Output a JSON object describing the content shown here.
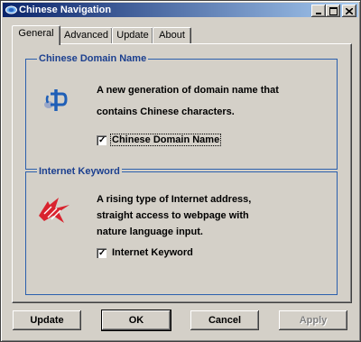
{
  "window": {
    "title": "Chinese Navigation"
  },
  "tabs": [
    {
      "label": "General",
      "active": true
    },
    {
      "label": "Advanced",
      "active": false
    },
    {
      "label": "Update",
      "active": false
    },
    {
      "label": "About",
      "active": false
    }
  ],
  "groups": {
    "domain": {
      "title": "Chinese Domain Name",
      "desc_line1": "A new generation of domain name that",
      "desc_line2": "contains Chinese characters.",
      "checkbox_label": "Chinese Domain Name",
      "checked": true,
      "icon": "chinese-domain-logo-icon"
    },
    "keyword": {
      "title": "Internet Keyword",
      "desc_line1": "A rising type of Internet address,",
      "desc_line2": "straight access to webpage with",
      "desc_line3": "nature language input.",
      "checkbox_label": "Internet Keyword",
      "checked": true,
      "icon": "internet-keyword-logo-icon"
    }
  },
  "buttons": {
    "update": "Update",
    "ok": "OK",
    "cancel": "Cancel",
    "apply": "Apply"
  },
  "colors": {
    "titlebar_start": "#0a246a",
    "titlebar_end": "#a6caf0",
    "group_title": "#1b3f8f",
    "logo_red": "#d9232e"
  }
}
